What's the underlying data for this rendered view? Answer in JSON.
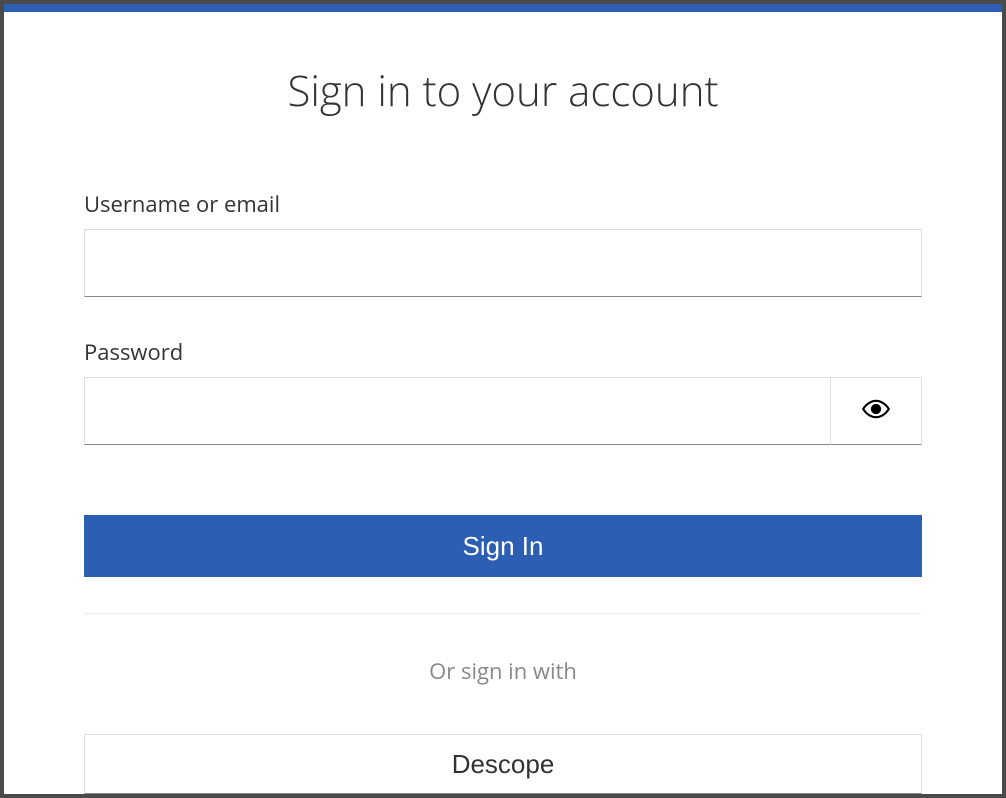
{
  "title": "Sign in to your account",
  "username": {
    "label": "Username or email",
    "value": ""
  },
  "password": {
    "label": "Password",
    "value": ""
  },
  "signin_button": "Sign In",
  "alt_signin_text": "Or sign in with",
  "alt_provider": "Descope"
}
